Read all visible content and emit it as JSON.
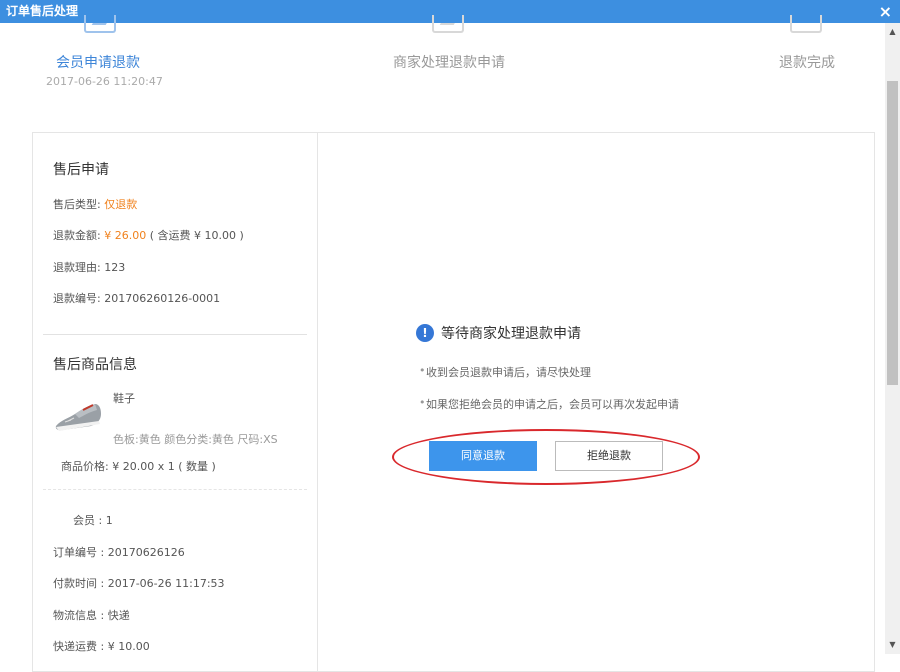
{
  "window": {
    "title": "订单售后处理",
    "close_glyph": "×"
  },
  "steps": [
    {
      "label": "会员申请退款",
      "time": "2017-06-26 11:20:47",
      "active": true
    },
    {
      "label": "商家处理退款申请",
      "time": "",
      "active": false
    },
    {
      "label": "退款完成",
      "time": "",
      "active": false
    }
  ],
  "after_sale": {
    "title": "售后申请",
    "type_label": "售后类型:",
    "type_value": "仅退款",
    "amount_label": "退款金额:",
    "amount_value": "¥ 26.00",
    "amount_note": "( 含运费 ¥ 10.00 )",
    "reason_label": "退款理由:",
    "reason_value": "123",
    "number_label": "退款编号:",
    "number_value": "201706260126-0001"
  },
  "product": {
    "title": "售后商品信息",
    "name": "鞋子",
    "spec": "色板:黄色 颜色分类:黄色 尺码:XS",
    "price_label": "商品价格:",
    "price_value": "¥ 20.00 x 1 ( 数量 )"
  },
  "order": {
    "member_label": "会员 :",
    "member_value": "1",
    "order_no_label": "订单编号 :",
    "order_no_value": "20170626126",
    "pay_time_label": "付款时间 :",
    "pay_time_value": "2017-06-26 11:17:53",
    "logistics_label": "物流信息 :",
    "logistics_value": "快递",
    "shipping_label": "快递运费 :",
    "shipping_value": "¥ 10.00"
  },
  "status": {
    "icon": "!",
    "title": "等待商家处理退款申请",
    "tips": [
      "收到会员退款申请后，请尽快处理",
      "如果您拒绝会员的申请之后，会员可以再次发起申请"
    ]
  },
  "actions": {
    "agree": "同意退款",
    "reject": "拒绝退款"
  },
  "colors": {
    "accent": "#3d8fe0",
    "highlight": "#f0821e",
    "annotation": "#d9282c"
  }
}
